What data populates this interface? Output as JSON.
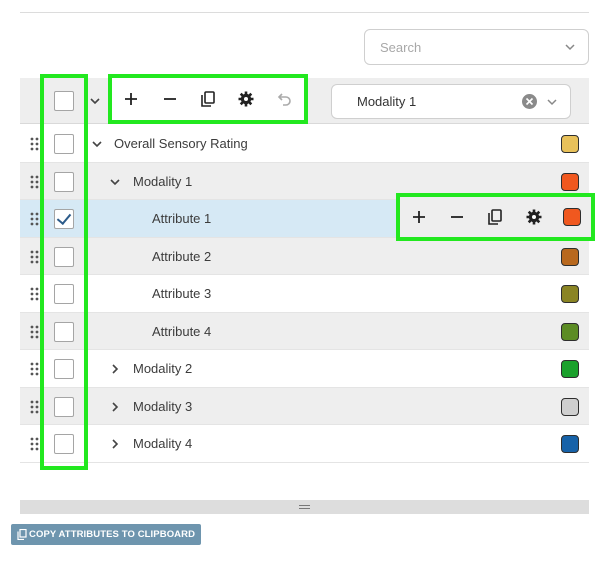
{
  "search": {
    "placeholder": "Search"
  },
  "header": {
    "selected_modality": "Modality 1"
  },
  "toolbar": {
    "buttons": [
      "add-icon",
      "remove-icon",
      "copy-icon",
      "gear-icon",
      "undo-icon"
    ]
  },
  "tree": {
    "rows": [
      {
        "label": "Overall Sensory Rating",
        "level": 0,
        "expander": "expanded",
        "checked": false,
        "color": "#e8c15a"
      },
      {
        "label": "Modality 1",
        "level": 1,
        "expander": "expanded",
        "checked": false,
        "color": "#f0581f"
      },
      {
        "label": "Attribute 1",
        "level": 2,
        "expander": "none",
        "checked": true,
        "color": "#f0581f"
      },
      {
        "label": "Attribute 2",
        "level": 2,
        "expander": "none",
        "checked": false,
        "color": "#b8681e"
      },
      {
        "label": "Attribute 3",
        "level": 2,
        "expander": "none",
        "checked": false,
        "color": "#8a8424"
      },
      {
        "label": "Attribute 4",
        "level": 2,
        "expander": "none",
        "checked": false,
        "color": "#5c8c24"
      },
      {
        "label": "Modality 2",
        "level": 1,
        "expander": "collapsed",
        "checked": false,
        "color": "#1ba12c"
      },
      {
        "label": "Modality 3",
        "level": 1,
        "expander": "collapsed",
        "checked": false,
        "color": "#cfcfcf"
      },
      {
        "label": "Modality 4",
        "level": 1,
        "expander": "collapsed",
        "checked": false,
        "color": "#1762a8"
      }
    ]
  },
  "footer": {
    "copy_label": "COPY ATTRIBUTES TO CLIPBOARD"
  },
  "colors": {
    "highlight": "#22e81f",
    "selected_row": "#d6e9f5",
    "button": "#6e95ae"
  }
}
